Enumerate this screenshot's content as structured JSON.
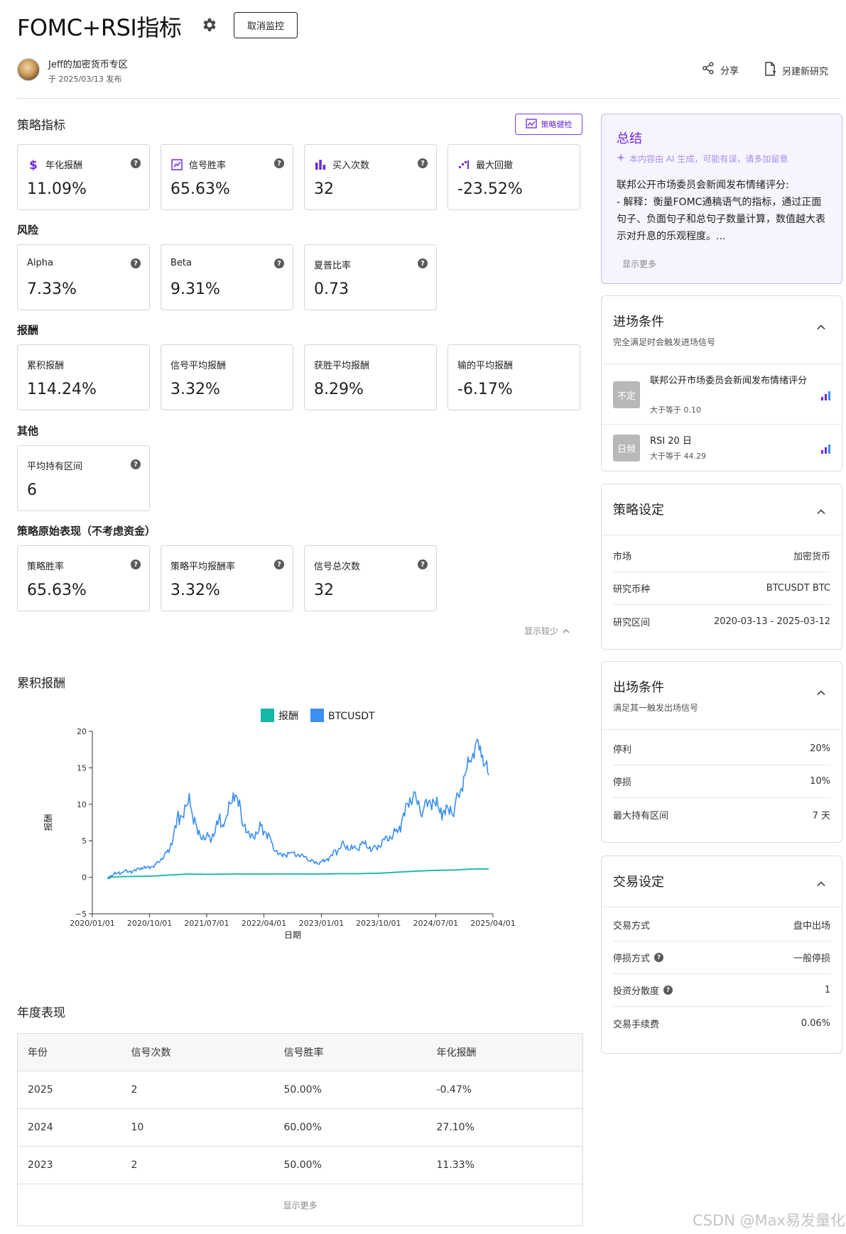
{
  "header": {
    "title": "FOMC+RSI指标",
    "unmonitor_label": "取消监控",
    "author": "Jeff的加密货币专区",
    "publish_date": "于 2025/03/13 发布",
    "share_label": "分享",
    "new_study_label": "另建新研究"
  },
  "indicators": {
    "heading": "策略指标",
    "health_label": "策略健检",
    "cards": [
      {
        "label": "年化报酬",
        "value": "11.09%",
        "icon": "dollar-icon"
      },
      {
        "label": "信号胜率",
        "value": "65.63%",
        "icon": "trend-chart-icon"
      },
      {
        "label": "买入次数",
        "value": "32",
        "icon": "bar-chart-icon"
      },
      {
        "label": "最大回撤",
        "value": "-23.52%",
        "icon": "drawdown-icon"
      }
    ]
  },
  "risk": {
    "heading": "风险",
    "cards": [
      {
        "label": "Alpha",
        "value": "7.33%"
      },
      {
        "label": "Beta",
        "value": "9.31%"
      },
      {
        "label": "夏普比率",
        "value": "0.73"
      }
    ]
  },
  "returns": {
    "heading": "报酬",
    "cards": [
      {
        "label": "累积报酬",
        "value": "114.24%"
      },
      {
        "label": "信号平均报酬",
        "value": "3.32%"
      },
      {
        "label": "获胜平均报酬",
        "value": "8.29%"
      },
      {
        "label": "输的平均报酬",
        "value": "-6.17%"
      }
    ]
  },
  "other": {
    "heading": "其他",
    "cards": [
      {
        "label": "平均持有区间",
        "value": "6"
      }
    ]
  },
  "raw": {
    "heading": "策略原始表现（不考虑资金）",
    "cards": [
      {
        "label": "策略胜率",
        "value": "65.63%"
      },
      {
        "label": "策略平均报酬率",
        "value": "3.32%"
      },
      {
        "label": "信号总次数",
        "value": "32"
      }
    ],
    "show_less": "显示较少"
  },
  "cumulative": {
    "heading": "累积报酬"
  },
  "chart_data": {
    "type": "line",
    "title": "",
    "xlabel": "日期",
    "ylabel": "报酬",
    "x_ticks": [
      "2020/01/01",
      "2020/10/01",
      "2021/07/01",
      "2022/04/01",
      "2023/01/01",
      "2023/10/01",
      "2024/07/01",
      "2025/04/01"
    ],
    "y_ticks": [
      -5,
      0,
      5,
      10,
      15,
      20
    ],
    "ylim": [
      -5,
      20
    ],
    "xlim": [
      "2020/01/01",
      "2025/04/01"
    ],
    "legend_position": "top",
    "grid": false,
    "series": [
      {
        "name": "报酬",
        "color": "#14b8a6",
        "x": [
          "2020/03/13",
          "2020/06/01",
          "2020/10/01",
          "2021/01/01",
          "2021/04/01",
          "2021/07/01",
          "2021/10/01",
          "2022/01/01",
          "2022/04/01",
          "2022/07/01",
          "2022/10/01",
          "2023/01/01",
          "2023/04/01",
          "2023/07/01",
          "2023/10/01",
          "2024/01/01",
          "2024/04/01",
          "2024/07/01",
          "2024/10/01",
          "2025/01/01",
          "2025/03/12"
        ],
        "y": [
          0,
          0.1,
          0.15,
          0.3,
          0.45,
          0.4,
          0.45,
          0.45,
          0.45,
          0.45,
          0.45,
          0.45,
          0.5,
          0.5,
          0.55,
          0.7,
          0.85,
          0.95,
          1.0,
          1.15,
          1.14
        ]
      },
      {
        "name": "BTCUSDT",
        "color": "#3b8ff0",
        "x": [
          "2020/03/13",
          "2020/06/01",
          "2020/09/01",
          "2020/11/01",
          "2021/01/01",
          "2021/02/20",
          "2021/04/14",
          "2021/05/20",
          "2021/07/20",
          "2021/09/07",
          "2021/09/25",
          "2021/11/10",
          "2021/12/15",
          "2022/01/22",
          "2022/03/28",
          "2022/05/12",
          "2022/06/18",
          "2022/08/14",
          "2022/11/10",
          "2022/12/31",
          "2023/03/15",
          "2023/04/14",
          "2023/06/15",
          "2023/07/15",
          "2023/09/11",
          "2023/10/25",
          "2023/12/31",
          "2024/03/14",
          "2024/05/01",
          "2024/06/07",
          "2024/08/05",
          "2024/09/30",
          "2024/11/12",
          "2024/12/17",
          "2025/01/20",
          "2025/02/10",
          "2025/03/12"
        ],
        "y": [
          0,
          0.8,
          1.1,
          1.8,
          3.8,
          8.5,
          10.2,
          6.0,
          5.5,
          8.0,
          7.0,
          11.5,
          8.5,
          5.6,
          7.0,
          4.5,
          3.0,
          3.6,
          2.2,
          2.0,
          3.6,
          4.4,
          4.0,
          4.6,
          4.0,
          5.0,
          6.6,
          11.0,
          9.0,
          10.5,
          8.5,
          9.5,
          13.0,
          16.5,
          18.5,
          16.5,
          14.0
        ]
      }
    ]
  },
  "yearly": {
    "heading": "年度表现",
    "columns": [
      "年份",
      "信号次数",
      "信号胜率",
      "年化报酬"
    ],
    "rows": [
      [
        "2025",
        "2",
        "50.00%",
        "-0.47%"
      ],
      [
        "2024",
        "10",
        "60.00%",
        "27.10%"
      ],
      [
        "2023",
        "2",
        "50.00%",
        "11.33%"
      ]
    ],
    "show_more": "显示更多"
  },
  "summary": {
    "title": "总结",
    "ai_note": "本内容由 AI 生成，可能有误，请多加留意",
    "body": "联邦公开市场委员会新闻发布情绪评分:\n- 解释：衡量FOMC通稿语气的指标，通过正面句子、负面句子和总句子数量计算，数值越大表示对升息的乐观程度。...",
    "show_more": "显示更多"
  },
  "entry": {
    "title": "进场条件",
    "subtitle": "完全满足时会触发进场信号",
    "conditions": [
      {
        "tag": "不定",
        "name": "联邦公开市场委员会新闻发布情绪评分",
        "rule": "大于等于 0.10"
      },
      {
        "tag": "日频",
        "name": "RSI 20 日",
        "rule": "大于等于 44.29"
      }
    ]
  },
  "strategy": {
    "title": "策略设定",
    "rows": [
      {
        "k": "市场",
        "v": "加密货币"
      },
      {
        "k": "研究币种",
        "v": "BTCUSDT BTC"
      },
      {
        "k": "研究区间",
        "v": "2020-03-13 - 2025-03-12"
      }
    ]
  },
  "exit": {
    "title": "出场条件",
    "subtitle": "满足其一触发出场信号",
    "rows": [
      {
        "k": "停利",
        "v": "20%"
      },
      {
        "k": "停损",
        "v": "10%"
      },
      {
        "k": "最大持有区间",
        "v": "7 天"
      }
    ]
  },
  "trade": {
    "title": "交易设定",
    "rows": [
      {
        "k": "交易方式",
        "v": "盘中出场"
      },
      {
        "k": "停损方式",
        "v": "一般停损"
      },
      {
        "k": "投资分散度",
        "v": "1"
      },
      {
        "k": "交易手续费",
        "v": "0.06%"
      }
    ]
  },
  "watermark": "CSDN @Max易发量化",
  "colors": {
    "accent": "#6d28d9",
    "series_return": "#14b8a6",
    "series_btc": "#3b8ff0"
  }
}
